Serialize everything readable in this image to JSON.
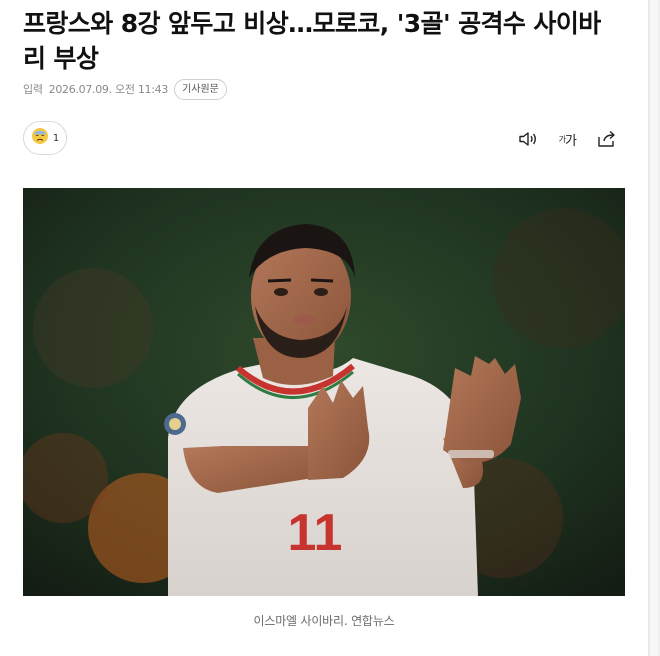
{
  "article": {
    "headline": "프랑스와 8강 앞두고 비상…모로코, '3골' 공격수 사이바리 부상",
    "meta_label": "입력",
    "date": "2026.07.09. 오전 11:43",
    "original_button": "기사원문"
  },
  "reaction": {
    "icon": "sad-face-emoji-icon",
    "count": "1"
  },
  "toolbar": {
    "listen_icon": "speaker-icon",
    "font_size_small": "가",
    "font_size_large": "가",
    "share_icon": "share-icon"
  },
  "photo": {
    "jersey_number": "11",
    "caption": "이스마엘 사이바리. 연합뉴스"
  }
}
